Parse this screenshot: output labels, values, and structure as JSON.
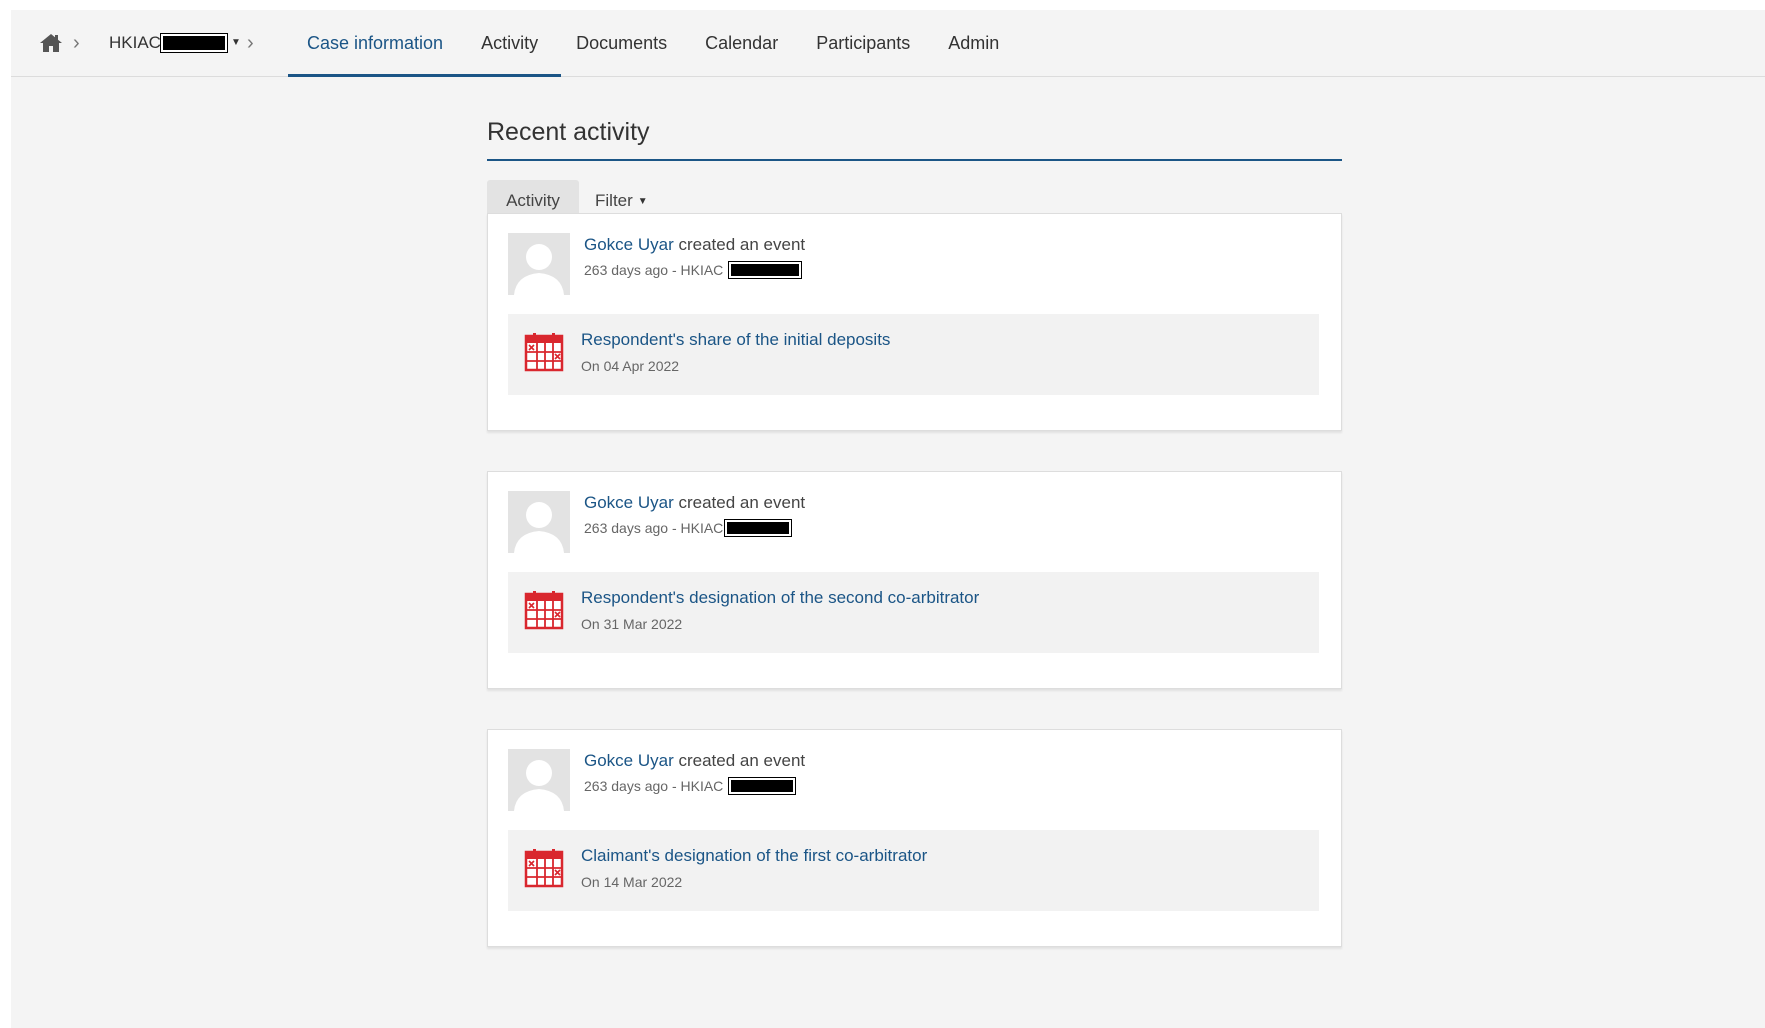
{
  "breadcrumb": {
    "case_label": "HKIAC"
  },
  "tabs": [
    {
      "label": "Case information"
    },
    {
      "label": "Activity"
    },
    {
      "label": "Documents"
    },
    {
      "label": "Calendar"
    },
    {
      "label": "Participants"
    },
    {
      "label": "Admin"
    }
  ],
  "active_tab": "Case information",
  "main": {
    "section_title": "Recent activity",
    "toolbar": {
      "activity_label": "Activity",
      "filter_label": "Filter"
    },
    "items": [
      {
        "user": "Gokce Uyar",
        "action": " created an event",
        "meta": "263 days ago - HKIAC",
        "event_title": "Respondent's share of the initial deposits",
        "event_date": "On 04 Apr 2022"
      },
      {
        "user": "Gokce Uyar",
        "action": " created an event",
        "meta": "263 days ago - HKIAC",
        "event_title": "Respondent's designation of the second co-arbitrator",
        "event_date": "On 31 Mar 2022"
      },
      {
        "user": "Gokce Uyar",
        "action": " created an event",
        "meta": "263 days ago - HKIAC",
        "event_title": "Claimant's designation of the first co-arbitrator",
        "event_date": "On 14 Mar 2022"
      }
    ]
  },
  "icons": {
    "home": "home-icon",
    "breadcrumb_separator": "chevron-right-icon",
    "dropdown": "caret-down-icon",
    "event": "calendar-icon",
    "avatar": "user-placeholder-icon"
  },
  "colors": {
    "accent": "#1b5586",
    "calendar_icon": "#d9272e",
    "page_bg": "#f4f4f4"
  }
}
